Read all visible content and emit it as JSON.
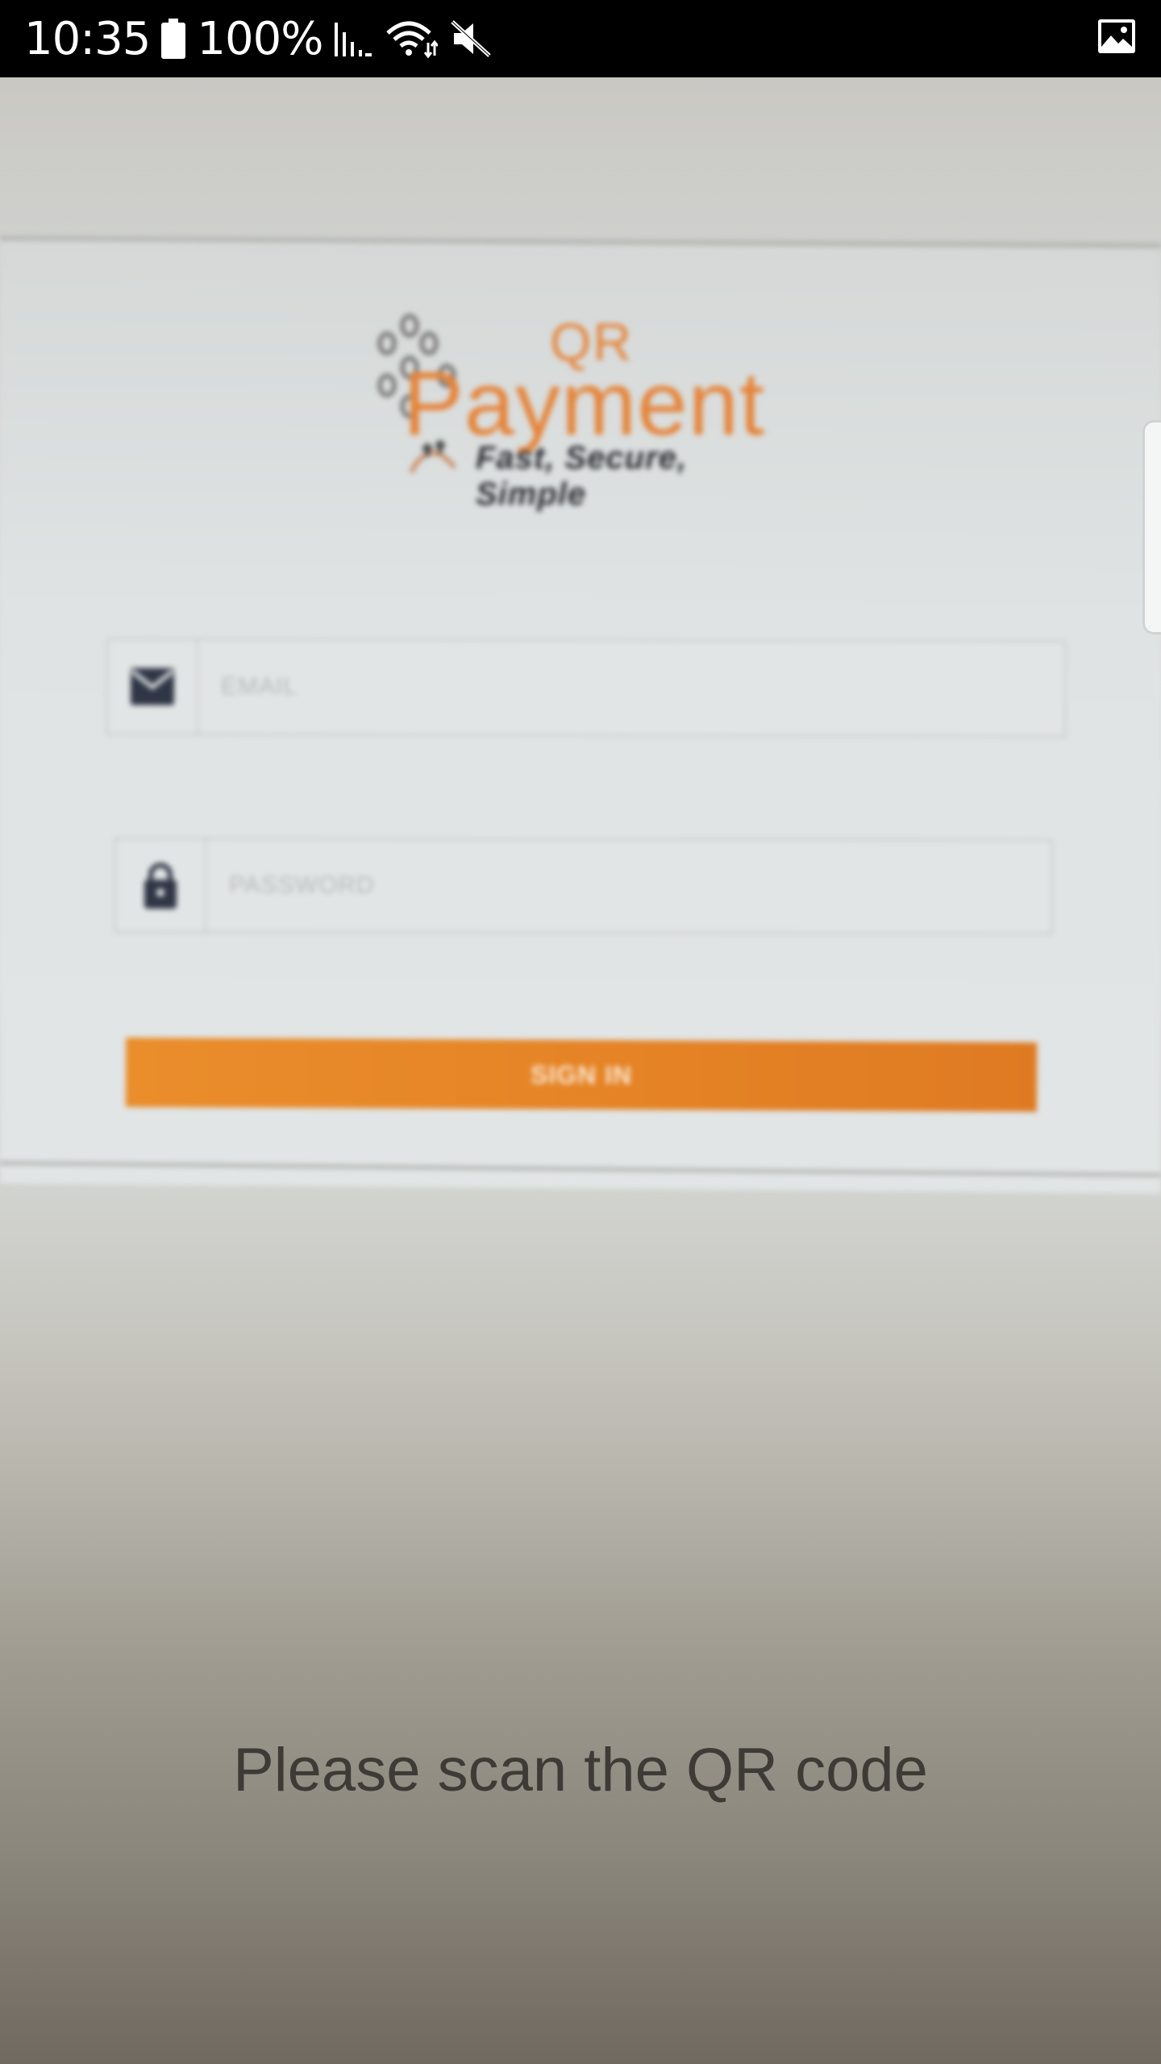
{
  "status_bar": {
    "time": "10:35",
    "battery_percent": "100%",
    "icons": [
      "battery-icon",
      "signal-icon",
      "wifi-icon",
      "mute-icon",
      "gallery-icon"
    ]
  },
  "viewfinder": {
    "logo": {
      "qr": "QR",
      "name": "Payment",
      "tagline": "Fast, Secure, Simple"
    },
    "email_field": {
      "placeholder": "EMAIL",
      "icon": "mail-icon"
    },
    "password_field": {
      "placeholder": "PASSWORD",
      "icon": "lock-icon"
    },
    "signin_label": "SIGN IN"
  },
  "prompt": "Please scan the QR code",
  "colors": {
    "accent": "#E5843A",
    "statusbar": "#000000"
  }
}
